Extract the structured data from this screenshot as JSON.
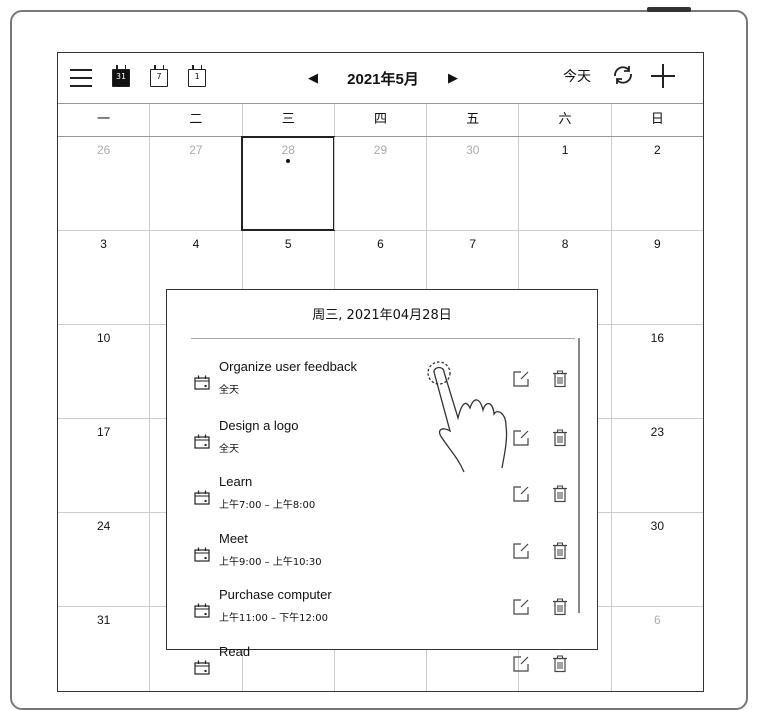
{
  "toolbar": {
    "menu_icon": "hamburger-menu-icon",
    "view_month_label": "31",
    "view_week_label": "7",
    "view_day_label": "1",
    "prev_icon": "◀",
    "month_label": "2021年5月",
    "next_icon": "▶",
    "today_label": "今天",
    "sync_icon": "sync-icon",
    "add_icon": "plus-icon"
  },
  "weekdays": [
    "一",
    "二",
    "三",
    "四",
    "五",
    "六",
    "日"
  ],
  "weeks": [
    [
      "26",
      "27",
      "28",
      "29",
      "30",
      "1",
      "2"
    ],
    [
      "3",
      "4",
      "5",
      "6",
      "7",
      "8",
      "9"
    ],
    [
      "10",
      "",
      "",
      "",
      "",
      "",
      "16"
    ],
    [
      "17",
      "",
      "",
      "",
      "",
      "",
      "23"
    ],
    [
      "24",
      "",
      "",
      "",
      "",
      "",
      "30"
    ],
    [
      "31",
      "",
      "",
      "",
      "",
      "",
      "6"
    ]
  ],
  "popup": {
    "title": "周三, 2021年04月28日",
    "events": [
      {
        "title": "Organize user feedback",
        "time": "全天"
      },
      {
        "title": "Design a logo",
        "time": "全天"
      },
      {
        "title": "Learn",
        "time": "上午7:00 – 上午8:00"
      },
      {
        "title": "Meet",
        "time": "上午9:00 – 上午10:30"
      },
      {
        "title": "Purchase computer",
        "time": "上午11:00 – 下午12:00"
      },
      {
        "title": "Read",
        "time": ""
      }
    ]
  },
  "colors": {
    "ink": "#111111",
    "muted_day": "#aaaaaa",
    "grid_line": "#cccccc"
  }
}
